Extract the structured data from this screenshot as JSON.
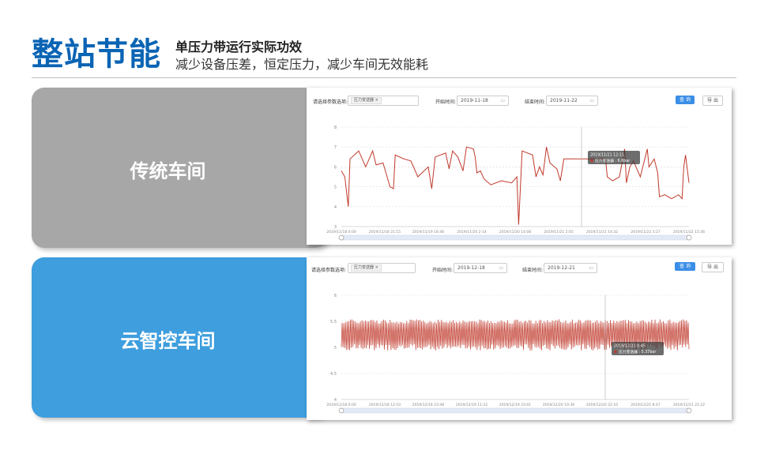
{
  "page": {
    "title": "整站节能",
    "subtitle1": "单压力带运行实际功效",
    "subtitle2": "减少设备压差，恒定压力，减少车间无效能耗"
  },
  "bands": [
    {
      "label": "传统车间",
      "color": "#a7a7a7"
    },
    {
      "label": "云智控车间",
      "color": "#3e9ede"
    }
  ],
  "filters": [
    {
      "param_label": "请选择参数选项:",
      "param_tag": "压力变送器",
      "start_label": "开始时间:",
      "start_value": "2019-11-18",
      "end_label": "结束时间:",
      "end_value": "2019-11-22",
      "query_label": "查 询",
      "export_label": "导 出"
    },
    {
      "param_label": "请选择参数选项:",
      "param_tag": "压力变送器",
      "start_label": "开始时间:",
      "start_value": "2019-12-18",
      "end_label": "结束时间:",
      "end_value": "2019-12-21",
      "query_label": "查 询",
      "export_label": "导 出"
    }
  ],
  "chart_data": [
    {
      "type": "line",
      "series": [
        {
          "name": "压力变送器",
          "color": "#c0392b"
        }
      ],
      "ylim": [
        3,
        8
      ],
      "yticks": [
        3,
        4,
        5,
        6,
        7,
        8
      ],
      "xticks": [
        "2019/11/18 0:00",
        "2019/11/18 21:15",
        "2019/11/19 16:46",
        "2019/11/20 2:14",
        "2019/11/20 14:08",
        "2019/11/21 2:05",
        "2019/11/21 14:32",
        "2019/11/22 3:27",
        "2019/11/22 15:36"
      ],
      "tooltip": {
        "time": "2019/11/21 12:11",
        "text": "压力变送器 : 6.6bar"
      },
      "segments": [
        [
          0.0,
          5.8
        ],
        [
          0.01,
          5.5
        ],
        [
          0.02,
          4.0
        ],
        [
          0.025,
          6.4
        ],
        [
          0.05,
          6.8
        ],
        [
          0.07,
          6.0
        ],
        [
          0.09,
          6.8
        ],
        [
          0.1,
          6.1
        ],
        [
          0.12,
          6.2
        ],
        [
          0.14,
          5.0
        ],
        [
          0.15,
          4.9
        ],
        [
          0.155,
          6.6
        ],
        [
          0.18,
          6.4
        ],
        [
          0.2,
          6.3
        ],
        [
          0.22,
          5.5
        ],
        [
          0.25,
          6.0
        ],
        [
          0.26,
          4.9
        ],
        [
          0.27,
          6.5
        ],
        [
          0.3,
          6.7
        ],
        [
          0.31,
          5.9
        ],
        [
          0.32,
          6.8
        ],
        [
          0.335,
          6.5
        ],
        [
          0.35,
          5.8
        ],
        [
          0.36,
          7.0
        ],
        [
          0.38,
          6.9
        ],
        [
          0.385,
          6.5
        ],
        [
          0.39,
          5.7
        ],
        [
          0.4,
          5.8
        ],
        [
          0.41,
          5.4
        ],
        [
          0.43,
          5.1
        ],
        [
          0.46,
          5.3
        ],
        [
          0.49,
          5.2
        ],
        [
          0.505,
          5.5
        ],
        [
          0.51,
          3.1
        ],
        [
          0.52,
          6.8
        ],
        [
          0.55,
          6.6
        ],
        [
          0.56,
          5.5
        ],
        [
          0.57,
          6.0
        ],
        [
          0.58,
          5.6
        ],
        [
          0.59,
          7.0
        ],
        [
          0.6,
          6.2
        ],
        [
          0.62,
          5.9
        ],
        [
          0.63,
          5.3
        ],
        [
          0.64,
          6.4
        ],
        [
          0.67,
          6.4
        ],
        [
          0.7,
          6.4
        ],
        [
          0.73,
          6.4
        ],
        [
          0.76,
          6.4
        ],
        [
          0.765,
          5.5
        ],
        [
          0.78,
          5.3
        ],
        [
          0.8,
          5.5
        ],
        [
          0.815,
          6.9
        ],
        [
          0.82,
          5.2
        ],
        [
          0.83,
          6.0
        ],
        [
          0.84,
          6.3
        ],
        [
          0.86,
          5.5
        ],
        [
          0.88,
          6.9
        ],
        [
          0.885,
          6.0
        ],
        [
          0.9,
          6.4
        ],
        [
          0.91,
          5.7
        ],
        [
          0.915,
          4.5
        ],
        [
          0.93,
          4.6
        ],
        [
          0.95,
          4.4
        ],
        [
          0.97,
          4.6
        ],
        [
          0.98,
          4.4
        ],
        [
          0.985,
          6.0
        ],
        [
          0.99,
          6.6
        ],
        [
          1.0,
          5.2
        ]
      ]
    },
    {
      "type": "line",
      "series": [
        {
          "name": "压力变送器",
          "color": "#c0392b"
        }
      ],
      "ylim": [
        4,
        6
      ],
      "yticks": [
        "4",
        "4.5",
        "5",
        "5.5",
        "6"
      ],
      "xticks": [
        "2019/12/18 0:00",
        "2019/12/18 12:10",
        "2019/12/18 23:48",
        "2019/12/19 11:22",
        "2019/12/19 23:01",
        "2019/12/20 10:36",
        "2019/12/20 22:10",
        "2019/12/21 8:47",
        "2019/12/21 21:22"
      ],
      "tooltip": {
        "time": "2019/12/21 0:45",
        "text": "压力变送器 : 5.37bar"
      },
      "band": [
        5.0,
        5.5
      ]
    }
  ]
}
